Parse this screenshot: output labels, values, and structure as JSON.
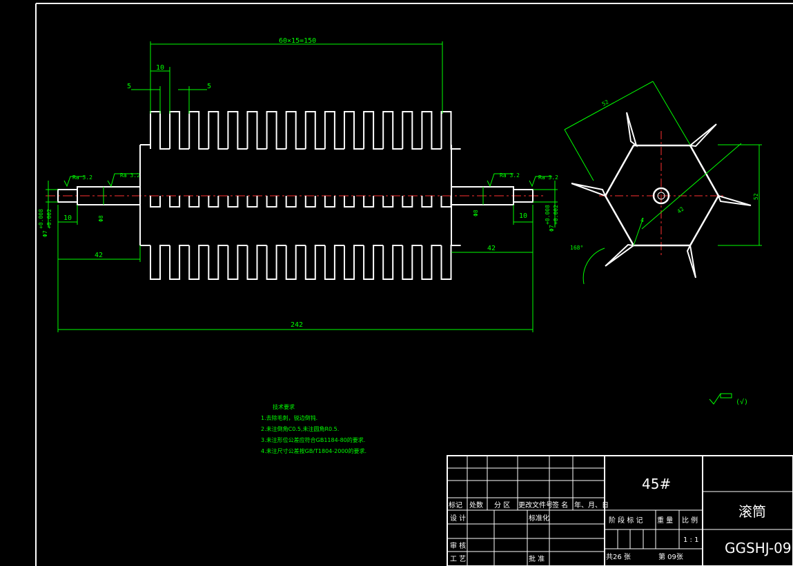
{
  "dimensions": {
    "tooth_pattern": "60×15=150",
    "pitch": "10",
    "gap_left": "5",
    "gap_right": "5",
    "end_len_left": "10",
    "end_len_right": "10",
    "shaft_left": "42",
    "shaft_right": "42",
    "total_length": "242",
    "dia_shaft_left": "Φ8",
    "dia_shaft_right": "Φ8",
    "dia_end_left": "Φ7",
    "dia_end_right": "Φ7",
    "tol_upper": "+0.008",
    "tol_lower": "+0.002",
    "roughness_1": "Ra 3.2",
    "roughness_2": "Ra 3.2",
    "roughness_3": "Ra 3.2",
    "roughness_4": "Ra 3.2",
    "side_width": "52",
    "side_height": "52",
    "side_diag": "42",
    "side_small": "4",
    "side_angle": "168°"
  },
  "roughness_symbol": {
    "paren_text": "(√)"
  },
  "notes": {
    "title": "技术要求",
    "items": [
      "1.去除毛刺，锐边倒钝.",
      "2.未注倒角C0.5,未注圆角R0.5.",
      "3.未注形位公差应符合GB1184-80的要求.",
      "4.未注尺寸公差按GB/T1804-2000的要求."
    ]
  },
  "title_block": {
    "material": "45#",
    "part_name": "滚筒",
    "drawing_no": "GGSHJ-09",
    "row_labels": [
      "标记",
      "处数",
      "分 区",
      "更改文件号",
      "签 名",
      "年、月、日"
    ],
    "design": "设 计",
    "standardize": "标准化",
    "check": "审 核",
    "process": "工 艺",
    "approve": "批 准",
    "stage_mark": "阶 段 标 记",
    "weight": "重 量",
    "scale": "比 例",
    "scale_value": "1 : 1",
    "sheets_total": "共26 张",
    "sheet_no": "第 09张"
  }
}
